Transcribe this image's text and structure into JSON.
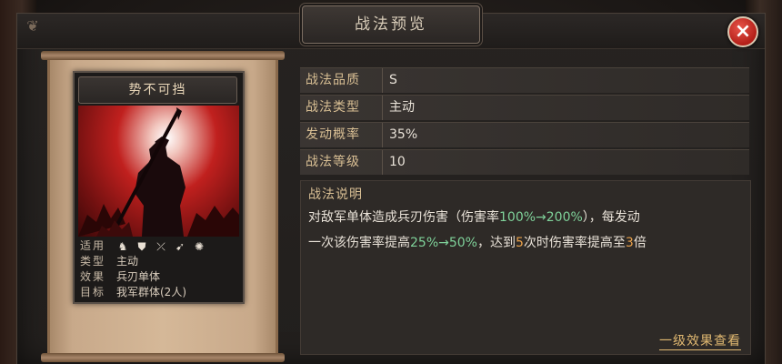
{
  "dialog": {
    "title": "战法预览",
    "close_label": "×"
  },
  "card": {
    "name": "势不可挡",
    "info": {
      "applicable_label": "适用",
      "type_label": "类型",
      "type_value": "主动",
      "effect_label": "效果",
      "effect_value": "兵刃单体",
      "target_label": "目标",
      "target_value": "我军群体(2人)"
    },
    "troop_icons": [
      "cavalry-icon",
      "shield-icon",
      "bow-icon",
      "spear-icon",
      "siege-icon"
    ]
  },
  "stats": [
    {
      "label": "战法品质",
      "value": "S"
    },
    {
      "label": "战法类型",
      "value": "主动"
    },
    {
      "label": "发动概率",
      "value": "35%"
    },
    {
      "label": "战法等级",
      "value": "10"
    }
  ],
  "description": {
    "title": "战法说明",
    "line1_a": "对敌军单体造成兵刃伤害（伤害率",
    "line1_hl": "100%→200%",
    "line1_b": "），每发动",
    "line2_a": "一次该伤害率提高",
    "line2_hl": "25%→50%",
    "line2_b": "，达到",
    "line2_num": "5",
    "line2_c": "次时伤害率提高至",
    "line2_num2": "3",
    "line2_d": "倍"
  },
  "detail_link": "一级效果查看",
  "colors": {
    "accent_gold": "#d9bf94",
    "highlight_green": "#7fd29a",
    "close_red": "#c8281f"
  }
}
